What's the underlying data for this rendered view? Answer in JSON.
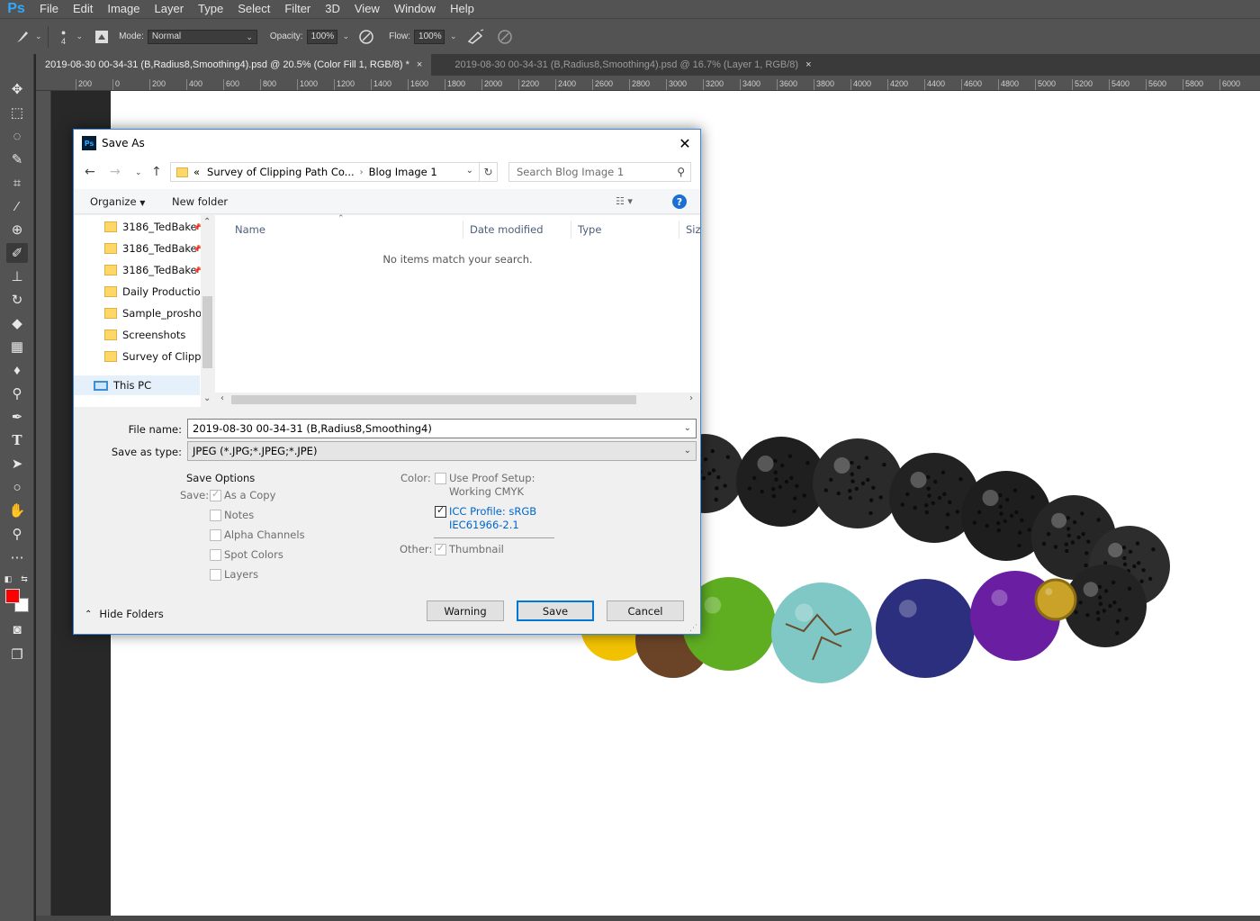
{
  "app": {
    "logo": "Ps"
  },
  "menubar": {
    "items": [
      "File",
      "Edit",
      "Image",
      "Layer",
      "Type",
      "Select",
      "Filter",
      "3D",
      "View",
      "Window",
      "Help"
    ]
  },
  "options": {
    "brush_size": "4",
    "mode_label": "Mode:",
    "mode_value": "Normal",
    "opacity_label": "Opacity:",
    "opacity_value": "100%",
    "flow_label": "Flow:",
    "flow_value": "100%"
  },
  "tabs": [
    {
      "label": "2019-08-30 00-34-31 (B,Radius8,Smoothing4).psd @ 20.5% (Color Fill 1, RGB/8) *",
      "close": "×"
    },
    {
      "label": "2019-08-30 00-34-31 (B,Radius8,Smoothing4).psd @ 16.7% (Layer 1, RGB/8)",
      "close": "×"
    }
  ],
  "ruler_top": [
    "200",
    "0",
    "200",
    "400",
    "600",
    "800",
    "1000",
    "1200",
    "1400",
    "1600",
    "1800",
    "2000",
    "2200",
    "2400",
    "2600",
    "2800",
    "3000",
    "3200",
    "3400",
    "3600",
    "3800",
    "4000",
    "4200",
    "4400",
    "4600",
    "4800",
    "5000",
    "5200",
    "5400",
    "5600",
    "5800",
    "6000"
  ],
  "colors": {
    "foreground": "#ff0000",
    "background": "#ffffff",
    "dialog_accent": "#0078d7"
  },
  "dialog": {
    "title": "Save As",
    "icon_text": "Ps",
    "close": "✕",
    "breadcrumb": [
      "Survey of Clipping Path Co...",
      "Blog Image 1"
    ],
    "breadcrumb_prefix": "«",
    "search_placeholder": "Search Blog Image 1",
    "organize": "Organize",
    "new_folder": "New folder",
    "help": "?",
    "nav_items": [
      "3186_TedBake",
      "3186_TedBake",
      "3186_TedBake",
      "Daily Production",
      "Sample_proshot",
      "Screenshots",
      "Survey of Clipping"
    ],
    "this_pc": "This PC",
    "columns": [
      "Name",
      "Date modified",
      "Type",
      "Size"
    ],
    "empty_message": "No items match your search.",
    "file_name_label": "File name:",
    "file_name_value": "2019-08-30 00-34-31 (B,Radius8,Smoothing4)",
    "save_type_label": "Save as type:",
    "save_type_value": "JPEG (*.JPG;*.JPEG;*.JPE)",
    "save_options_title": "Save Options",
    "save_label": "Save:",
    "opt_as_copy": "As a Copy",
    "opt_notes": "Notes",
    "opt_alpha": "Alpha Channels",
    "opt_spot": "Spot Colors",
    "opt_layers": "Layers",
    "color_label": "Color:",
    "opt_proof": "Use Proof Setup:",
    "opt_proof_sub": "Working CMYK",
    "opt_icc": "ICC Profile:  sRGB",
    "opt_icc_sub": "IEC61966-2.1",
    "other_label": "Other:",
    "opt_thumbnail": "Thumbnail",
    "hide_folders": "Hide Folders",
    "btn_warning": "Warning",
    "btn_save": "Save",
    "btn_cancel": "Cancel"
  },
  "beads": [
    {
      "color": "#2b2b2b",
      "kind": "lava"
    },
    {
      "color": "#1f1f1f",
      "kind": "lava"
    },
    {
      "color": "#2a2a2a",
      "kind": "lava"
    },
    {
      "color": "#222222",
      "kind": "lava"
    },
    {
      "color": "#1e1e1e",
      "kind": "lava"
    },
    {
      "color": "#262626",
      "kind": "lava"
    },
    {
      "color": "#2d2d2d",
      "kind": "lava"
    },
    {
      "color": "#232323",
      "kind": "lava"
    },
    {
      "color": "#f2c200",
      "kind": "citrine"
    },
    {
      "color": "#6b4427",
      "kind": "tigereye"
    },
    {
      "color": "#5fae22",
      "kind": "jade"
    },
    {
      "color": "#7fc8c6",
      "kind": "turquoise"
    },
    {
      "color": "#2b2f7e",
      "kind": "lapis"
    },
    {
      "color": "#6a1fa3",
      "kind": "amethyst"
    },
    {
      "color": "#c9a227",
      "kind": "gold"
    }
  ]
}
